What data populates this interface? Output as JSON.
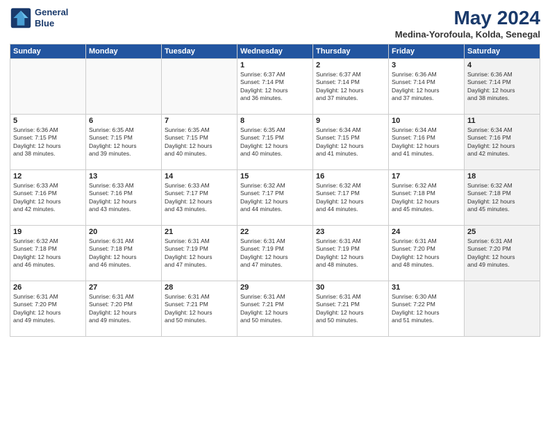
{
  "header": {
    "logo_line1": "General",
    "logo_line2": "Blue",
    "month": "May 2024",
    "location": "Medina-Yorofoula, Kolda, Senegal"
  },
  "days_of_week": [
    "Sunday",
    "Monday",
    "Tuesday",
    "Wednesday",
    "Thursday",
    "Friday",
    "Saturday"
  ],
  "weeks": [
    [
      {
        "day": "",
        "text": "",
        "shaded": false
      },
      {
        "day": "",
        "text": "",
        "shaded": false
      },
      {
        "day": "",
        "text": "",
        "shaded": false
      },
      {
        "day": "1",
        "text": "Sunrise: 6:37 AM\nSunset: 7:14 PM\nDaylight: 12 hours\nand 36 minutes.",
        "shaded": false
      },
      {
        "day": "2",
        "text": "Sunrise: 6:37 AM\nSunset: 7:14 PM\nDaylight: 12 hours\nand 37 minutes.",
        "shaded": false
      },
      {
        "day": "3",
        "text": "Sunrise: 6:36 AM\nSunset: 7:14 PM\nDaylight: 12 hours\nand 37 minutes.",
        "shaded": false
      },
      {
        "day": "4",
        "text": "Sunrise: 6:36 AM\nSunset: 7:14 PM\nDaylight: 12 hours\nand 38 minutes.",
        "shaded": true
      }
    ],
    [
      {
        "day": "5",
        "text": "Sunrise: 6:36 AM\nSunset: 7:15 PM\nDaylight: 12 hours\nand 38 minutes.",
        "shaded": false
      },
      {
        "day": "6",
        "text": "Sunrise: 6:35 AM\nSunset: 7:15 PM\nDaylight: 12 hours\nand 39 minutes.",
        "shaded": false
      },
      {
        "day": "7",
        "text": "Sunrise: 6:35 AM\nSunset: 7:15 PM\nDaylight: 12 hours\nand 40 minutes.",
        "shaded": false
      },
      {
        "day": "8",
        "text": "Sunrise: 6:35 AM\nSunset: 7:15 PM\nDaylight: 12 hours\nand 40 minutes.",
        "shaded": false
      },
      {
        "day": "9",
        "text": "Sunrise: 6:34 AM\nSunset: 7:15 PM\nDaylight: 12 hours\nand 41 minutes.",
        "shaded": false
      },
      {
        "day": "10",
        "text": "Sunrise: 6:34 AM\nSunset: 7:16 PM\nDaylight: 12 hours\nand 41 minutes.",
        "shaded": false
      },
      {
        "day": "11",
        "text": "Sunrise: 6:34 AM\nSunset: 7:16 PM\nDaylight: 12 hours\nand 42 minutes.",
        "shaded": true
      }
    ],
    [
      {
        "day": "12",
        "text": "Sunrise: 6:33 AM\nSunset: 7:16 PM\nDaylight: 12 hours\nand 42 minutes.",
        "shaded": false
      },
      {
        "day": "13",
        "text": "Sunrise: 6:33 AM\nSunset: 7:16 PM\nDaylight: 12 hours\nand 43 minutes.",
        "shaded": false
      },
      {
        "day": "14",
        "text": "Sunrise: 6:33 AM\nSunset: 7:17 PM\nDaylight: 12 hours\nand 43 minutes.",
        "shaded": false
      },
      {
        "day": "15",
        "text": "Sunrise: 6:32 AM\nSunset: 7:17 PM\nDaylight: 12 hours\nand 44 minutes.",
        "shaded": false
      },
      {
        "day": "16",
        "text": "Sunrise: 6:32 AM\nSunset: 7:17 PM\nDaylight: 12 hours\nand 44 minutes.",
        "shaded": false
      },
      {
        "day": "17",
        "text": "Sunrise: 6:32 AM\nSunset: 7:18 PM\nDaylight: 12 hours\nand 45 minutes.",
        "shaded": false
      },
      {
        "day": "18",
        "text": "Sunrise: 6:32 AM\nSunset: 7:18 PM\nDaylight: 12 hours\nand 45 minutes.",
        "shaded": true
      }
    ],
    [
      {
        "day": "19",
        "text": "Sunrise: 6:32 AM\nSunset: 7:18 PM\nDaylight: 12 hours\nand 46 minutes.",
        "shaded": false
      },
      {
        "day": "20",
        "text": "Sunrise: 6:31 AM\nSunset: 7:18 PM\nDaylight: 12 hours\nand 46 minutes.",
        "shaded": false
      },
      {
        "day": "21",
        "text": "Sunrise: 6:31 AM\nSunset: 7:19 PM\nDaylight: 12 hours\nand 47 minutes.",
        "shaded": false
      },
      {
        "day": "22",
        "text": "Sunrise: 6:31 AM\nSunset: 7:19 PM\nDaylight: 12 hours\nand 47 minutes.",
        "shaded": false
      },
      {
        "day": "23",
        "text": "Sunrise: 6:31 AM\nSunset: 7:19 PM\nDaylight: 12 hours\nand 48 minutes.",
        "shaded": false
      },
      {
        "day": "24",
        "text": "Sunrise: 6:31 AM\nSunset: 7:20 PM\nDaylight: 12 hours\nand 48 minutes.",
        "shaded": false
      },
      {
        "day": "25",
        "text": "Sunrise: 6:31 AM\nSunset: 7:20 PM\nDaylight: 12 hours\nand 49 minutes.",
        "shaded": true
      }
    ],
    [
      {
        "day": "26",
        "text": "Sunrise: 6:31 AM\nSunset: 7:20 PM\nDaylight: 12 hours\nand 49 minutes.",
        "shaded": false
      },
      {
        "day": "27",
        "text": "Sunrise: 6:31 AM\nSunset: 7:20 PM\nDaylight: 12 hours\nand 49 minutes.",
        "shaded": false
      },
      {
        "day": "28",
        "text": "Sunrise: 6:31 AM\nSunset: 7:21 PM\nDaylight: 12 hours\nand 50 minutes.",
        "shaded": false
      },
      {
        "day": "29",
        "text": "Sunrise: 6:31 AM\nSunset: 7:21 PM\nDaylight: 12 hours\nand 50 minutes.",
        "shaded": false
      },
      {
        "day": "30",
        "text": "Sunrise: 6:31 AM\nSunset: 7:21 PM\nDaylight: 12 hours\nand 50 minutes.",
        "shaded": false
      },
      {
        "day": "31",
        "text": "Sunrise: 6:30 AM\nSunset: 7:22 PM\nDaylight: 12 hours\nand 51 minutes.",
        "shaded": false
      },
      {
        "day": "",
        "text": "",
        "shaded": true
      }
    ]
  ]
}
